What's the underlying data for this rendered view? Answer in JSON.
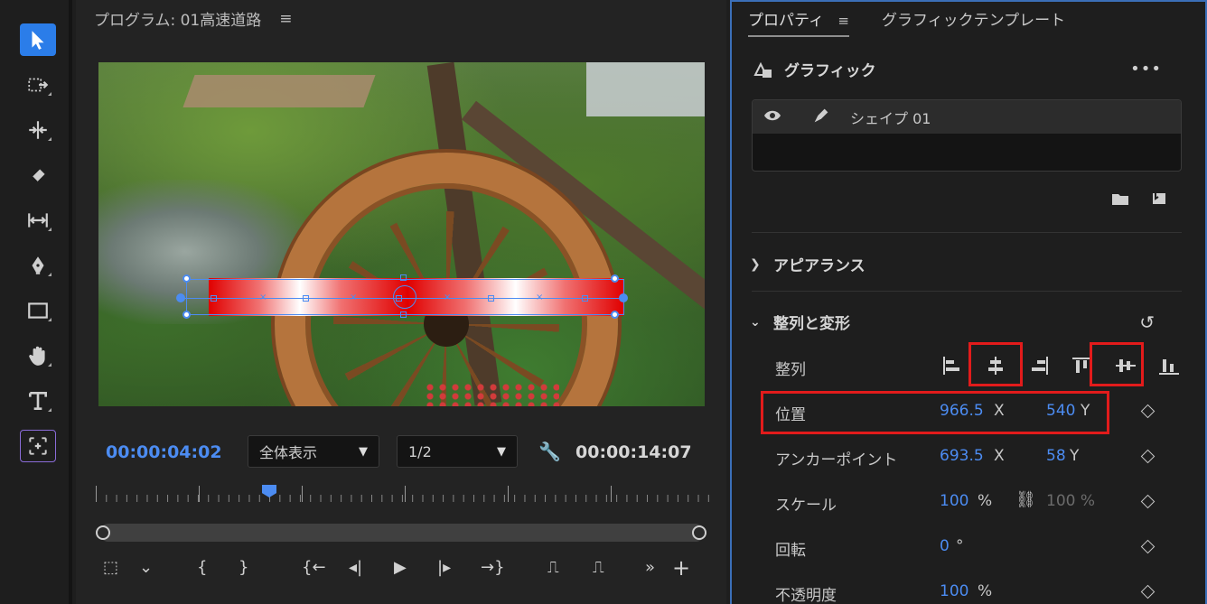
{
  "toolbar": {
    "tools": [
      {
        "name": "selection-tool",
        "icon": "arrow-pointer-icon"
      },
      {
        "name": "track-select-tool",
        "icon": "track-select-icon"
      },
      {
        "name": "ripple-edit-tool",
        "icon": "ripple-edit-icon"
      },
      {
        "name": "razor-tool",
        "icon": "razor-icon"
      },
      {
        "name": "slip-tool",
        "icon": "slip-icon"
      },
      {
        "name": "pen-tool",
        "icon": "pen-icon"
      },
      {
        "name": "rectangle-tool",
        "icon": "rectangle-icon"
      },
      {
        "name": "hand-tool",
        "icon": "hand-icon"
      },
      {
        "name": "type-tool",
        "icon": "type-icon"
      },
      {
        "name": "transform-tool",
        "icon": "transform-icon"
      }
    ]
  },
  "monitor": {
    "title": "プログラム: 01高速道路",
    "menu": "≡",
    "timecode_current": "00:00:04:02",
    "zoom_select": "全体表示",
    "resolution_select": "1/2",
    "timecode_duration": "00:00:14:07",
    "transport": {
      "safe_margins": "⬚",
      "chevron": "⌄",
      "mark_in": "{",
      "mark_out": "}",
      "go_to_in": "{←",
      "step_back": "◂|",
      "play": "▶",
      "step_forward": "|▸",
      "go_to_out": "→}",
      "lift": "⎍",
      "extract": "⎍",
      "more": "»",
      "add": "+"
    }
  },
  "properties": {
    "tabs": [
      {
        "label": "プロパティ",
        "active": true
      },
      {
        "label": "グラフィックテンプレート",
        "active": false
      }
    ],
    "tab_menu": "≡",
    "graphic_title": "グラフィック",
    "more": "•••",
    "layer_name": "シェイプ 01",
    "appearance_section": "アピアランス",
    "align_transform_section": "整列と変形",
    "align_label": "整列",
    "rows": {
      "position": {
        "label": "位置",
        "x": "966.5",
        "x_axis": "X",
        "y": "540",
        "y_axis": "Y"
      },
      "anchor": {
        "label": "アンカーポイント",
        "x": "693.5",
        "x_axis": "X",
        "y": "58",
        "y_axis": "Y"
      },
      "scale": {
        "label": "スケール",
        "value": "100",
        "unit": "%",
        "value2": "100 %"
      },
      "rotation": {
        "label": "回転",
        "value": "0",
        "unit": "°"
      },
      "opacity": {
        "label": "不透明度",
        "value": "100",
        "unit": "%"
      }
    }
  },
  "colors": {
    "accent_blue": "#4c8cf2",
    "highlight_red": "#e21b1b",
    "panel_border": "#3b6fb8"
  }
}
